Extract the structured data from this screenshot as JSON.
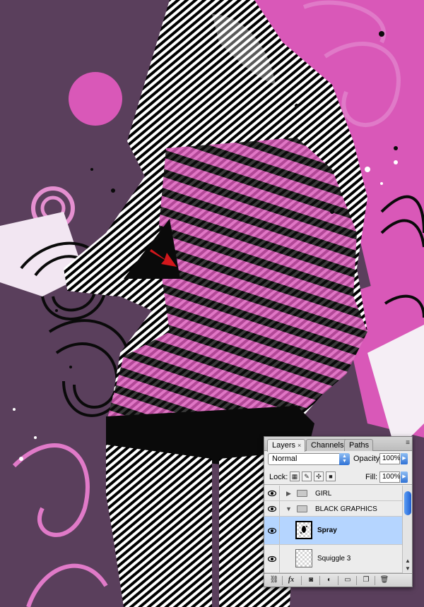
{
  "layers_panel": {
    "tabs": [
      {
        "label": "Layers",
        "active": true,
        "close": "×"
      },
      {
        "label": "Channels",
        "active": false
      },
      {
        "label": "Paths",
        "active": false
      }
    ],
    "panel_menu_icon": "≡",
    "blend_mode": "Normal",
    "opacity_label": "Opacity:",
    "opacity_value": "100%",
    "lock_label": "Lock:",
    "fill_label": "Fill:",
    "fill_value": "100%",
    "layers": [
      {
        "name": "GIRL",
        "type": "group",
        "expanded": false,
        "visible": true,
        "selected": false
      },
      {
        "name": "BLACK GRAPHICS",
        "type": "group",
        "expanded": true,
        "visible": true,
        "selected": false
      },
      {
        "name": "Spray",
        "type": "layer",
        "visible": true,
        "selected": true
      },
      {
        "name": "Squiggle 3",
        "type": "layer",
        "visible": true,
        "selected": false
      }
    ],
    "bottom_buttons": [
      "link-icon",
      "fx-icon",
      "mask-icon",
      "adjustment-icon",
      "new-group-icon",
      "new-layer-icon",
      "trash-icon"
    ],
    "fx_label": "fx"
  },
  "colors": {
    "background_purple": "#5a3f5c",
    "pink": "#d958b8",
    "selection_blue": "#b5d5ff",
    "accent_red": "#d3171c"
  }
}
